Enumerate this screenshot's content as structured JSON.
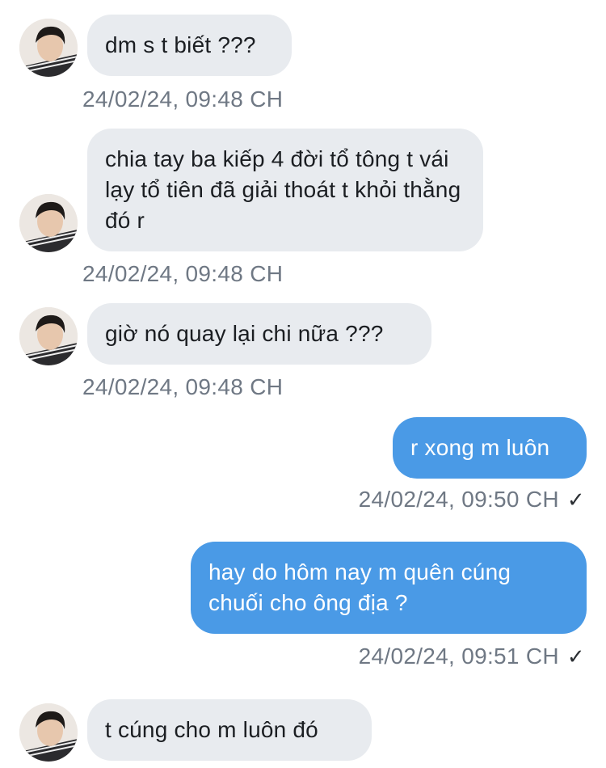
{
  "conversation": {
    "messages": [
      {
        "direction": "in",
        "text": "dm s t biết ???",
        "time": "24/02/24, 09:48 CH"
      },
      {
        "direction": "in",
        "text": "chia tay ba kiếp 4 đời tổ tông t vái lạy tổ tiên đã giải thoát t khỏi thằng đó r",
        "time": "24/02/24, 09:48 CH"
      },
      {
        "direction": "in",
        "text": "giờ nó quay lại chi nữa ???",
        "time": "24/02/24, 09:48 CH"
      },
      {
        "direction": "out",
        "text": "r xong m luôn",
        "time": "24/02/24, 09:50 CH",
        "status": "✓"
      },
      {
        "direction": "out",
        "text": "hay do hôm nay m quên cúng chuối cho ông địa ?",
        "time": "24/02/24, 09:51 CH",
        "status": "✓"
      },
      {
        "direction": "in",
        "text": "t cúng cho m luôn đó",
        "time": ""
      }
    ]
  },
  "colors": {
    "incoming_bubble": "#e8ebef",
    "outgoing_bubble": "#4a9ae6",
    "timestamp": "#6f7884"
  },
  "icons": {
    "avatar": "contact-avatar-photo",
    "read_receipt": "checkmark-icon"
  }
}
